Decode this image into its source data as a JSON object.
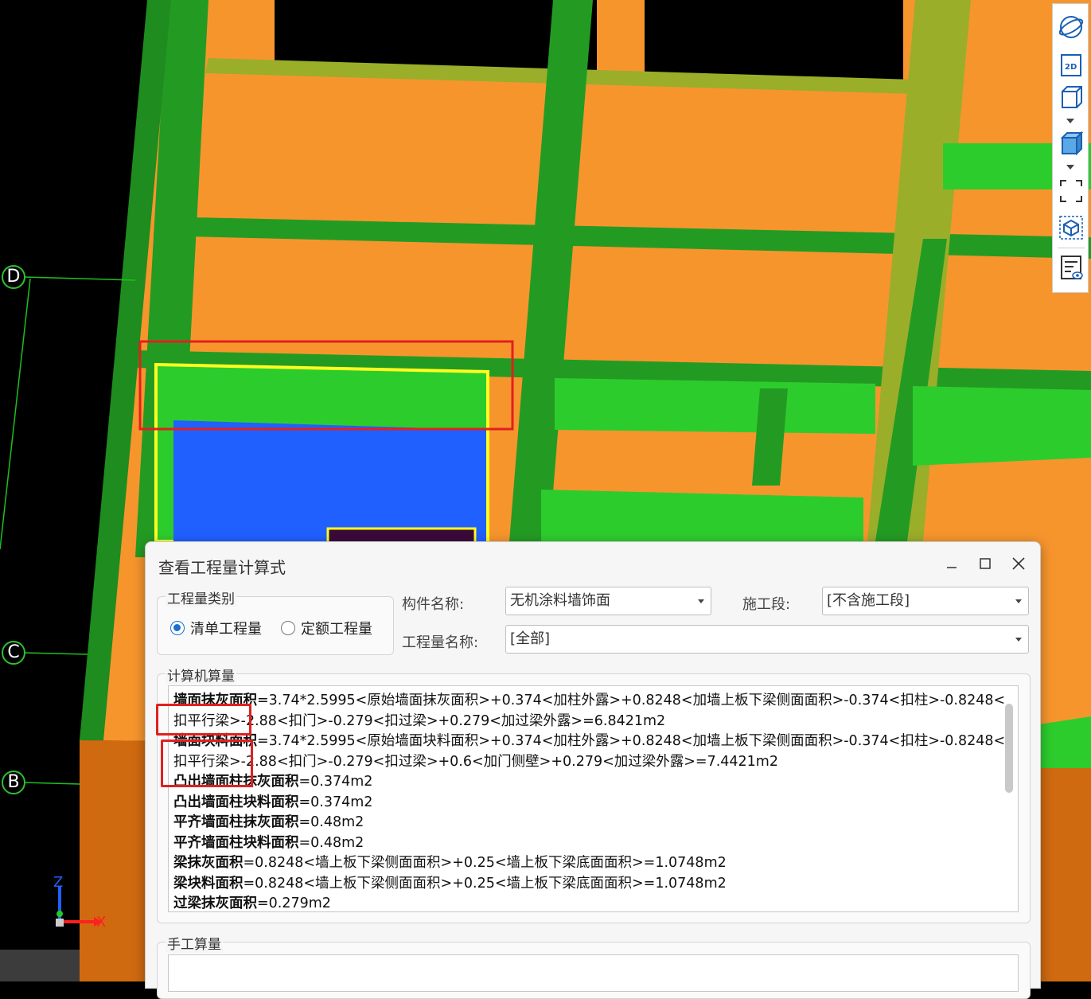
{
  "viewport": {
    "axis_labels": [
      "D",
      "C",
      "B"
    ],
    "axis_gizmo": {
      "z_label": "Z",
      "x_label": "X"
    },
    "colors": {
      "background": "#000000",
      "wall": "#f7952d",
      "beam": "#2db52d",
      "selected_face": "#2060ff",
      "highlight": "#ffff20"
    }
  },
  "toolbar": {
    "items": [
      "orbit-icon",
      "2d-view-icon",
      "3d-view-icon",
      "shaded-cube-icon",
      "fit-view-icon",
      "component-view-icon",
      "report-view-icon"
    ],
    "view_2d_label": "2D"
  },
  "dialog": {
    "title": "查看工程量计算式",
    "quantity_type_group": {
      "label": "工程量类别",
      "options": [
        {
          "label": "清单工程量",
          "selected": true
        },
        {
          "label": "定额工程量",
          "selected": false
        }
      ]
    },
    "component_name": {
      "label": "构件名称:",
      "value": "无机涂料墙饰面"
    },
    "construction_stage": {
      "label": "施工段:",
      "value": "[不含施工段]"
    },
    "quantity_name": {
      "label": "工程量名称:",
      "value": "[全部]"
    },
    "computer_calc": {
      "label": "计算机算量",
      "lines": [
        {
          "name": "墙面抹灰面积",
          "expr": "=3.74*2.5995<原始墙面抹灰面积>+0.374<加柱外露>+0.8248<加墙上板下梁侧面面积>-0.374<扣柱>-0.8248<"
        },
        {
          "name": "",
          "expr": "扣平行梁>-2.88<扣门>-0.279<扣过梁>+0.279<加过梁外露>=6.8421m2"
        },
        {
          "name": "墙面块料面积",
          "expr": "=3.74*2.5995<原始墙面块料面积>+0.374<加柱外露>+0.8248<加墙上板下梁侧面面积>-0.374<扣柱>-0.8248<"
        },
        {
          "name": "",
          "expr": "扣平行梁>-2.88<扣门>-0.279<扣过梁>+0.6<加门侧壁>+0.279<加过梁外露>=7.4421m2"
        },
        {
          "name": "凸出墙面柱抹灰面积",
          "expr": "=0.374m2"
        },
        {
          "name": "凸出墙面柱块料面积",
          "expr": "=0.374m2"
        },
        {
          "name": "平齐墙面柱抹灰面积",
          "expr": "=0.48m2"
        },
        {
          "name": "平齐墙面柱块料面积",
          "expr": "=0.48m2"
        },
        {
          "name": "梁抹灰面积",
          "expr": "=0.8248<墙上板下梁侧面面积>+0.25<墙上板下梁底面面积>=1.0748m2"
        },
        {
          "name": "梁块料面积",
          "expr": "=0.8248<墙上板下梁侧面面积>+0.25<墙上板下梁底面面积>=1.0748m2"
        },
        {
          "name": "过梁抹灰面积",
          "expr": "=0.279m2"
        }
      ]
    },
    "manual_calc": {
      "label": "手工算量",
      "value": ""
    }
  }
}
